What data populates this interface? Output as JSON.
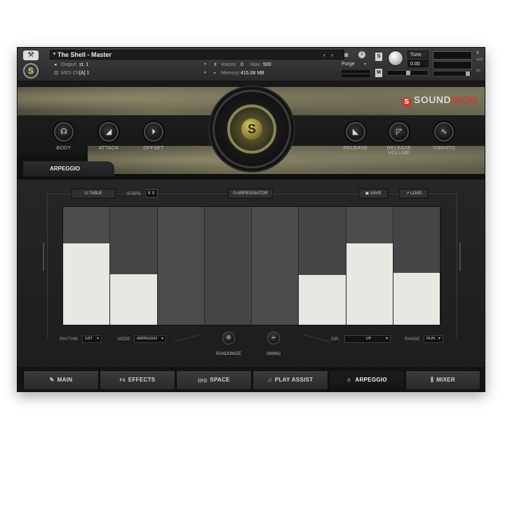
{
  "header": {
    "instrument_name": "The Shell - Master",
    "output_label": "Output:",
    "output_value": "st. 1",
    "midi_label": "MIDI Ch:",
    "midi_value": "[A] 1",
    "voices_label": "Voices:",
    "voices_value": "0",
    "max_label": "Max:",
    "max_value": "500",
    "memory_label": "Memory:",
    "memory_value": "415.08 MB",
    "purge_label": "Purge",
    "solo_label": "S",
    "mute_label": "M",
    "tune_label": "Tune",
    "tune_value": "0.00",
    "close_glyph": "x",
    "aux_label": "aux",
    "pv_label": "pv"
  },
  "brand": {
    "name_part1": "SOUND",
    "name_part2": "IRON",
    "logo_letter": "S",
    "accent_color": "#c8402f"
  },
  "knobs_left": [
    {
      "label": "BODY",
      "icon": "body-icon",
      "glyph": "☊"
    },
    {
      "label": "ATTACK",
      "icon": "attack-ramp-icon",
      "glyph": "◢"
    },
    {
      "label": "OFFSET",
      "icon": "offset-icon",
      "glyph": "⏵"
    }
  ],
  "knobs_right": [
    {
      "label": "RELEASE",
      "icon": "release-ramp-icon",
      "glyph": "◣"
    },
    {
      "label": "RELEASE VOLUME",
      "icon": "release-volume-icon",
      "glyph": "◸"
    },
    {
      "label": "VIBRATO",
      "icon": "sine-wave-icon",
      "glyph": "∿"
    }
  ],
  "page_tab": "ARPEGGIO",
  "arp": {
    "table_label": "TABLE",
    "steps_label": "STEPS",
    "steps_value": "8",
    "arpeggiator_label": "ARPEGGIATOR",
    "save_label": "SAVE",
    "load_label": "LOAD",
    "step_levels": [
      0.69,
      0.43,
      0.0,
      0.0,
      0.0,
      0.42,
      0.69,
      0.44
    ],
    "rhythm_label": "RHYTHM",
    "rhythm_value": "1/8T",
    "mode_label": "MODE",
    "mode_value": "ARPEGGIO",
    "randomize_label": "RANDOMIZE",
    "swing_label": "SWING",
    "dir_label": "DIR.",
    "dir_value": "UP",
    "range_label": "RANGE",
    "range_value": "RUN"
  },
  "tabs": [
    {
      "label": "MAIN",
      "icon": "guitar-icon",
      "glyph": "✎",
      "active": false
    },
    {
      "label": "EFFECTS",
      "icon": "fx-icon",
      "glyph": "FX",
      "active": false
    },
    {
      "label": "SPACE",
      "icon": "space-icon",
      "glyph": "((o))",
      "active": false
    },
    {
      "label": "PLAY ASSIST",
      "icon": "music-note-icon",
      "glyph": "♫",
      "active": false
    },
    {
      "label": "ARPEGGIO",
      "icon": "arpeggio-icon",
      "glyph": "♬",
      "active": true
    },
    {
      "label": "MIXER",
      "icon": "mixer-icon",
      "glyph": "⫼",
      "active": false
    }
  ]
}
